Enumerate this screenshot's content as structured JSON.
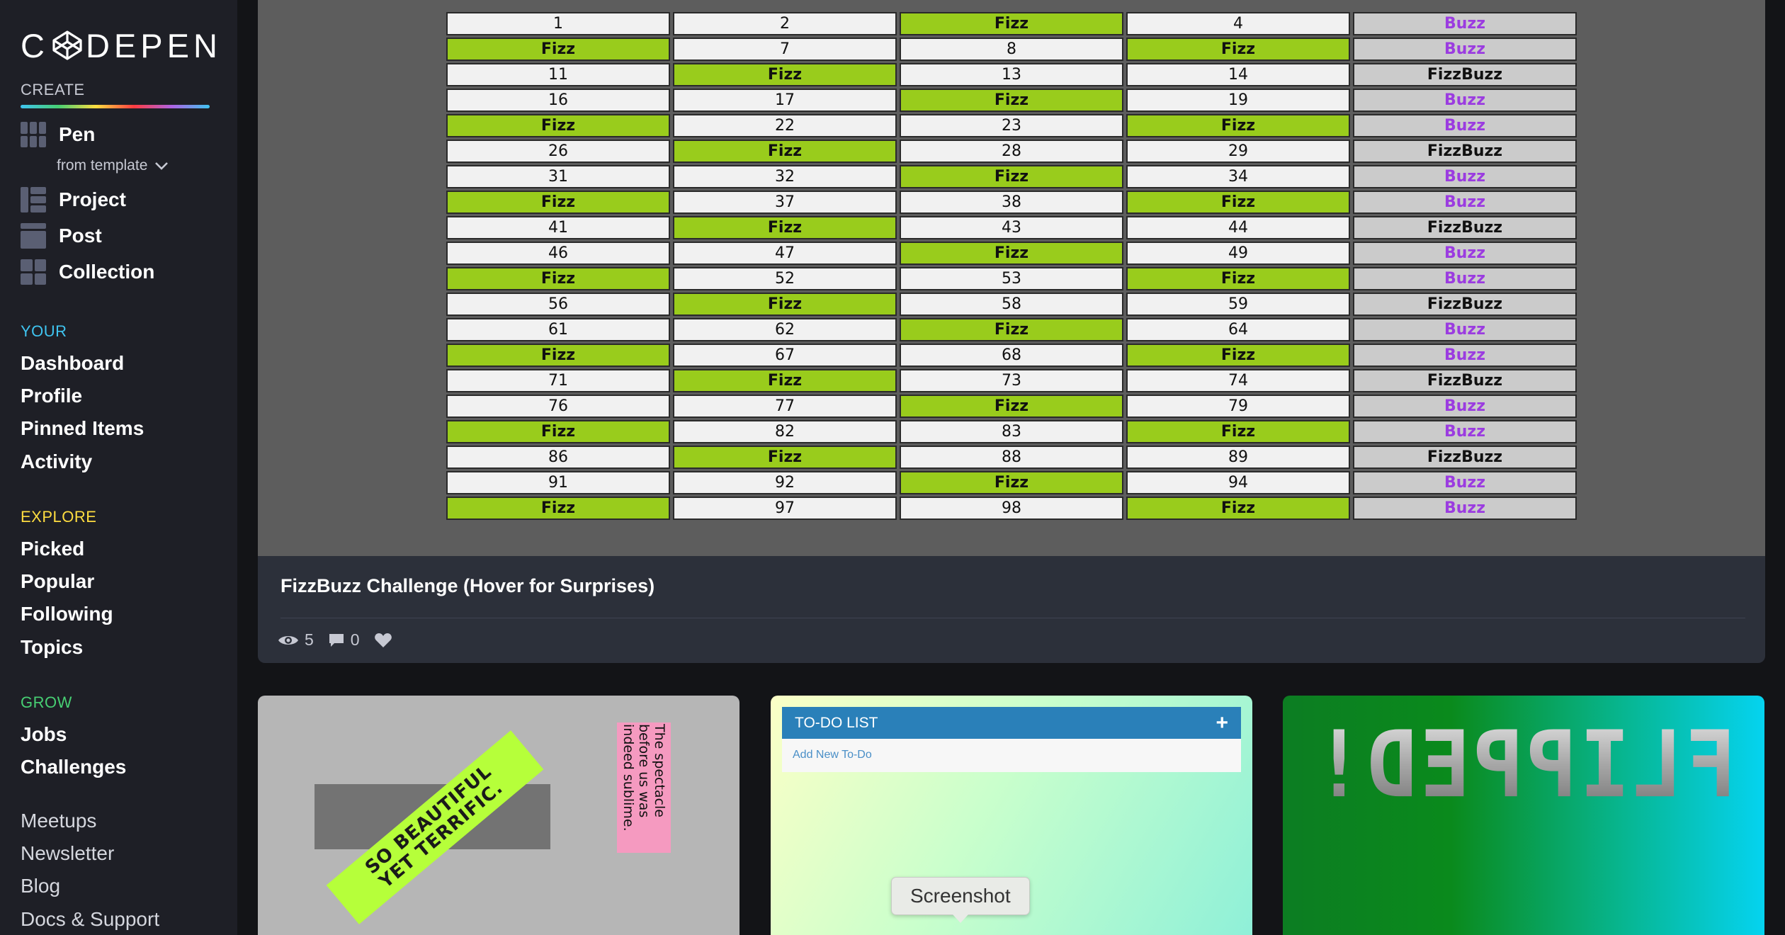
{
  "sidebar": {
    "logo": "CODEPEN",
    "create_label": "CREATE",
    "create_items": [
      {
        "label": "Pen",
        "icon": "pen-grid-icon"
      },
      {
        "label": "Project",
        "icon": "project-icon"
      },
      {
        "label": "Post",
        "icon": "post-icon"
      },
      {
        "label": "Collection",
        "icon": "collection-icon"
      }
    ],
    "from_template": "from template",
    "your_label": "YOUR",
    "your_links": [
      "Dashboard",
      "Profile",
      "Pinned Items",
      "Activity"
    ],
    "explore_label": "EXPLORE",
    "explore_links": [
      "Picked",
      "Popular",
      "Following",
      "Topics"
    ],
    "grow_label": "GROW",
    "grow_links": [
      "Jobs",
      "Challenges"
    ],
    "more_links": [
      "Meetups",
      "Newsletter",
      "Blog",
      "Docs & Support"
    ],
    "colors": {
      "your": "#3fc4f0",
      "explore": "#ffdd40",
      "grow": "#47cf73"
    }
  },
  "pen": {
    "title": "FizzBuzz Challenge (Hover for Surprises)",
    "views": "5",
    "comments": "0",
    "rows": [
      [
        "1",
        "2",
        "Fizz",
        "4",
        "Buzz"
      ],
      [
        "Fizz",
        "7",
        "8",
        "Fizz",
        "Buzz"
      ],
      [
        "11",
        "Fizz",
        "13",
        "14",
        "FizzBuzz"
      ],
      [
        "16",
        "17",
        "Fizz",
        "19",
        "Buzz"
      ],
      [
        "Fizz",
        "22",
        "23",
        "Fizz",
        "Buzz"
      ],
      [
        "26",
        "Fizz",
        "28",
        "29",
        "FizzBuzz"
      ],
      [
        "31",
        "32",
        "Fizz",
        "34",
        "Buzz"
      ],
      [
        "Fizz",
        "37",
        "38",
        "Fizz",
        "Buzz"
      ],
      [
        "41",
        "Fizz",
        "43",
        "44",
        "FizzBuzz"
      ],
      [
        "46",
        "47",
        "Fizz",
        "49",
        "Buzz"
      ],
      [
        "Fizz",
        "52",
        "53",
        "Fizz",
        "Buzz"
      ],
      [
        "56",
        "Fizz",
        "58",
        "59",
        "FizzBuzz"
      ],
      [
        "61",
        "62",
        "Fizz",
        "64",
        "Buzz"
      ],
      [
        "Fizz",
        "67",
        "68",
        "Fizz",
        "Buzz"
      ],
      [
        "71",
        "Fizz",
        "73",
        "74",
        "FizzBuzz"
      ],
      [
        "76",
        "77",
        "Fizz",
        "79",
        "Buzz"
      ],
      [
        "Fizz",
        "82",
        "83",
        "Fizz",
        "Buzz"
      ],
      [
        "86",
        "Fizz",
        "88",
        "89",
        "FizzBuzz"
      ],
      [
        "91",
        "92",
        "Fizz",
        "94",
        "Buzz"
      ],
      [
        "Fizz",
        "97",
        "98",
        "Fizz",
        "Buzz"
      ]
    ]
  },
  "cards": {
    "card1": {
      "banner_line1": "SO BEAUTIFUL",
      "banner_line2": "YET TERRIFIC.",
      "note": "The spectacle before us was indeed sublime."
    },
    "card2": {
      "title": "TO-DO LIST",
      "add_button": "+",
      "placeholder": "Add New To-Do",
      "tooltip": "Screenshot"
    },
    "card3": {
      "text": "FLIPPED!"
    }
  }
}
